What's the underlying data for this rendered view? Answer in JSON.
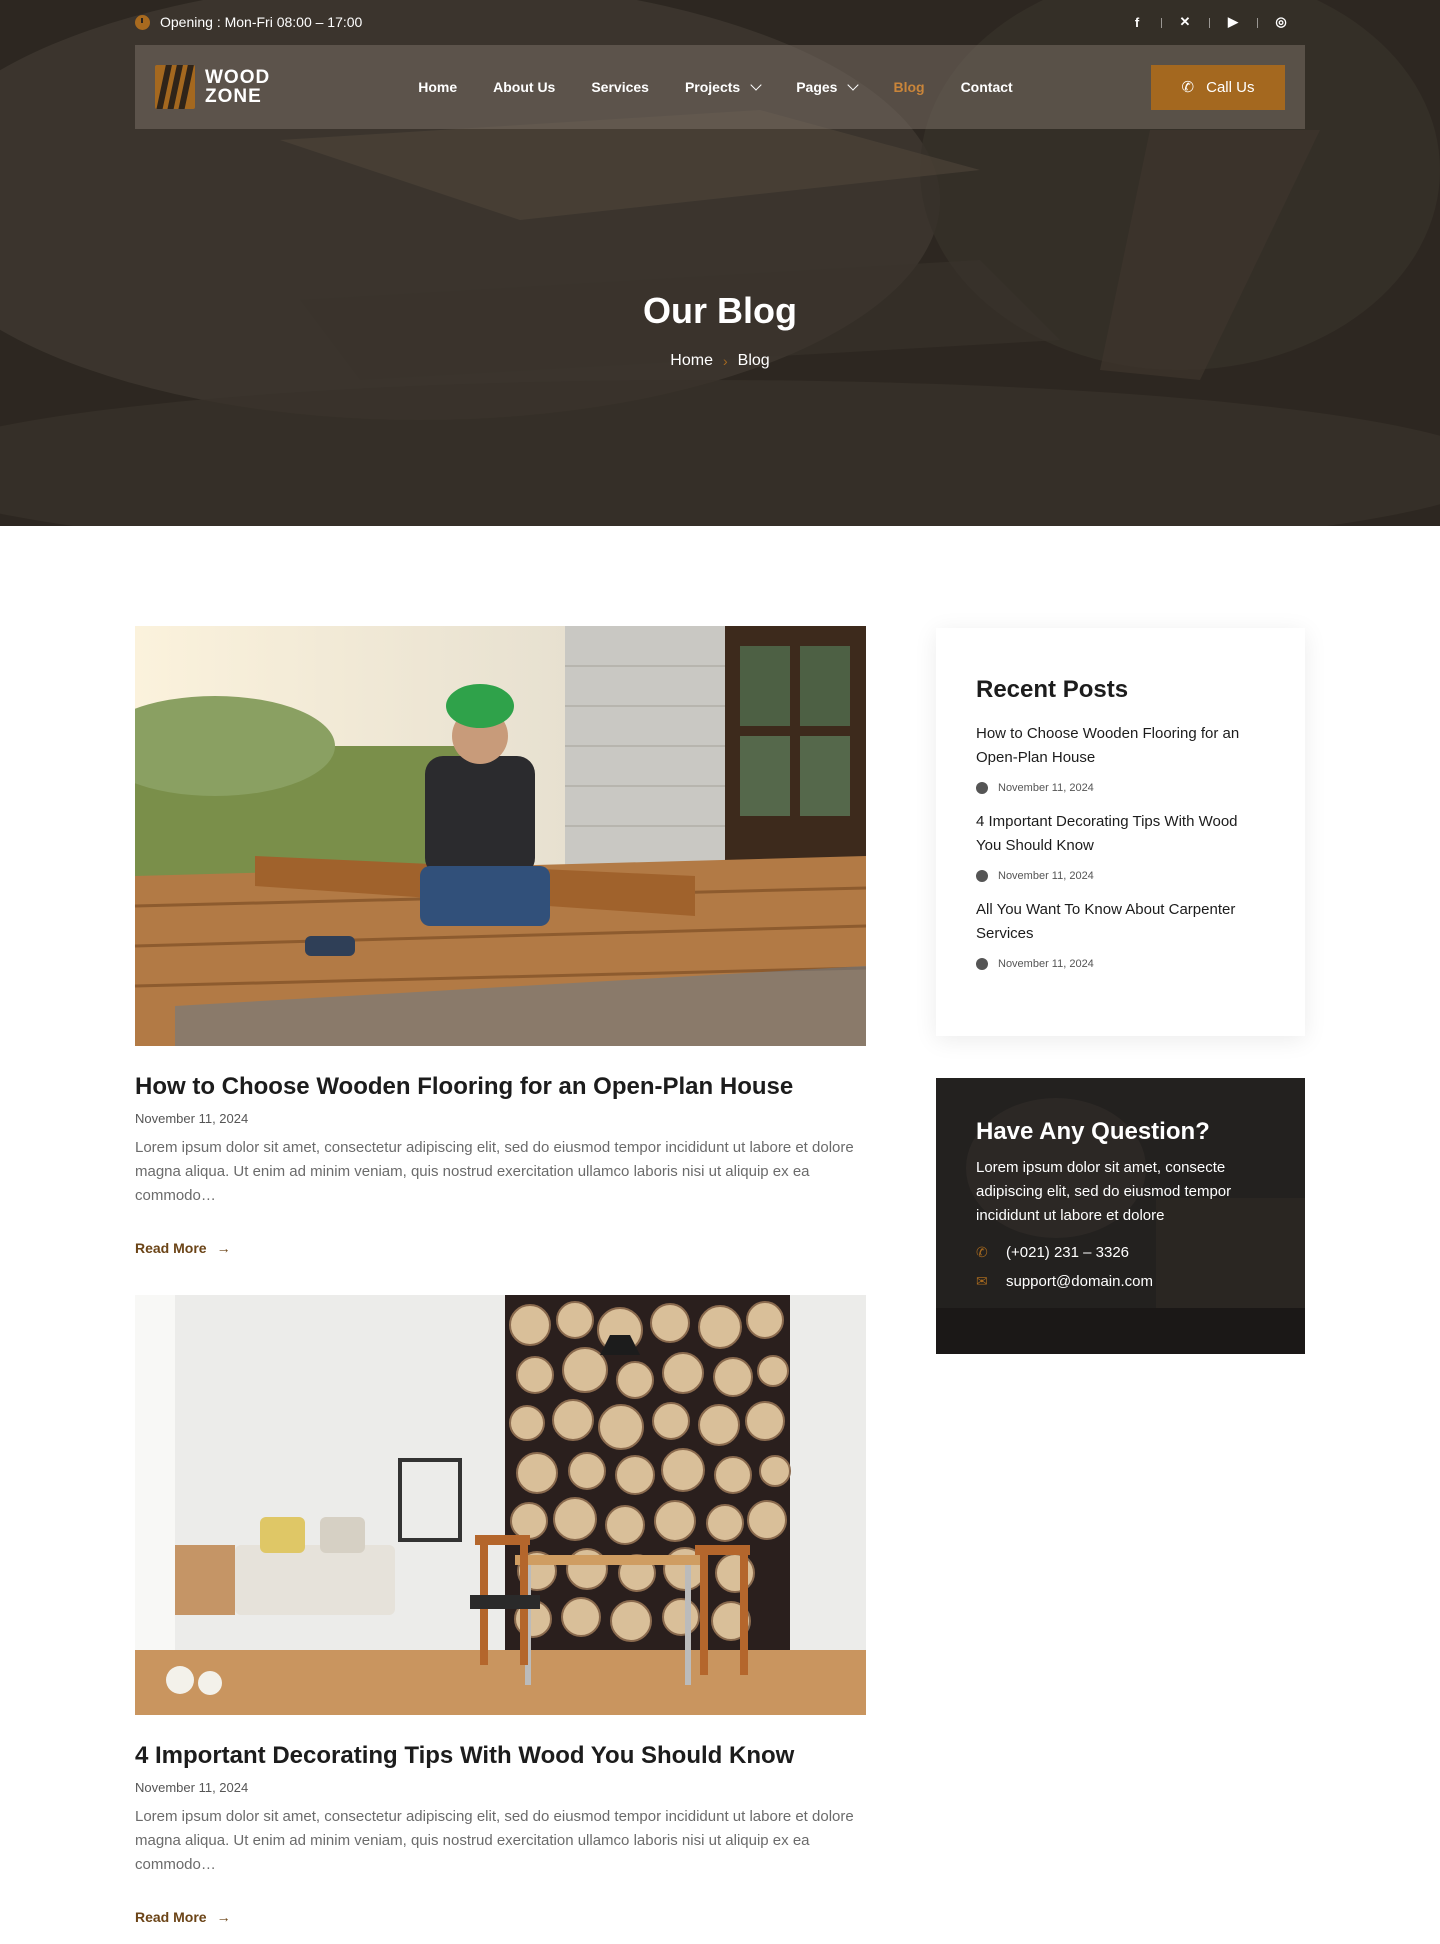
{
  "topbar": {
    "opening": "Opening : Mon-Fri 08:00 – 17:00",
    "socials": [
      {
        "icon": "facebook-icon",
        "glyph": "f"
      },
      {
        "icon": "x-icon",
        "glyph": "✕"
      },
      {
        "icon": "youtube-icon",
        "glyph": "▶"
      },
      {
        "icon": "instagram-icon",
        "glyph": "◎"
      }
    ]
  },
  "nav": {
    "logo_line1": "WOOD",
    "logo_line2": "ZONE",
    "items": [
      {
        "label": "Home"
      },
      {
        "label": "About Us"
      },
      {
        "label": "Services"
      },
      {
        "label": "Projects"
      },
      {
        "label": "Pages"
      },
      {
        "label": "Blog"
      },
      {
        "label": "Contact"
      }
    ],
    "cta": "Call Us"
  },
  "hero": {
    "title": "Our Blog",
    "breadcrumb": [
      "Home",
      "Blog"
    ]
  },
  "posts": [
    {
      "title": "How to Choose Wooden Flooring for an Open-Plan House",
      "date": "November 11, 2024",
      "excerpt": "Lorem ipsum dolor sit amet, consectetur adipiscing elit, sed do eiusmod tempor incididunt ut labore et dolore magna aliqua. Ut enim ad minim veniam, quis nostrud exercitation ullamco laboris nisi ut aliquip ex ea commodo…",
      "read_more": "Read More"
    },
    {
      "title": "4 Important Decorating Tips With Wood You Should Know",
      "date": "November 11, 2024",
      "excerpt": "Lorem ipsum dolor sit amet, consectetur adipiscing elit, sed do eiusmod tempor incididunt ut labore et dolore magna aliqua. Ut enim ad minim veniam, quis nostrud exercitation ullamco laboris nisi ut aliquip ex ea commodo…",
      "read_more": "Read More"
    }
  ],
  "sidebar": {
    "recent_title": "Recent Posts",
    "recent": [
      {
        "title": "How to Choose Wooden Flooring for an Open-Plan House",
        "date": "November 11, 2024"
      },
      {
        "title": "4 Important Decorating Tips With Wood You Should Know",
        "date": "November 11, 2024"
      },
      {
        "title": "All You Want To Know About Carpenter Services",
        "date": "November 11, 2024"
      }
    ],
    "question_title": "Have Any Question?",
    "question_text": "Lorem ipsum dolor sit amet, consecte adipiscing elit, sed do eiusmod tempor incididunt ut labore et dolore",
    "phone": "(+021) 231 – 3326",
    "email": "support@domain.com"
  },
  "colors": {
    "accent": "#a4681f",
    "active_nav": "#c9853a",
    "read_more": "#6b4417"
  }
}
